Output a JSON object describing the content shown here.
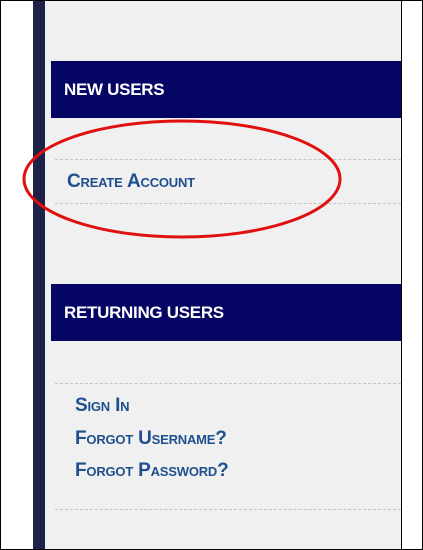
{
  "new_users": {
    "header": "NEW USERS",
    "links": [
      "Create Account"
    ]
  },
  "returning_users": {
    "header": "RETURNING USERS",
    "links": [
      "Sign In",
      "Forgot Username?",
      "Forgot Password?"
    ]
  },
  "colors": {
    "header_bg": "#050563",
    "link": "#1f4f8e",
    "panel_bg": "#f0f0f0",
    "stripe": "#1e2248",
    "annotation": "#e01010"
  }
}
